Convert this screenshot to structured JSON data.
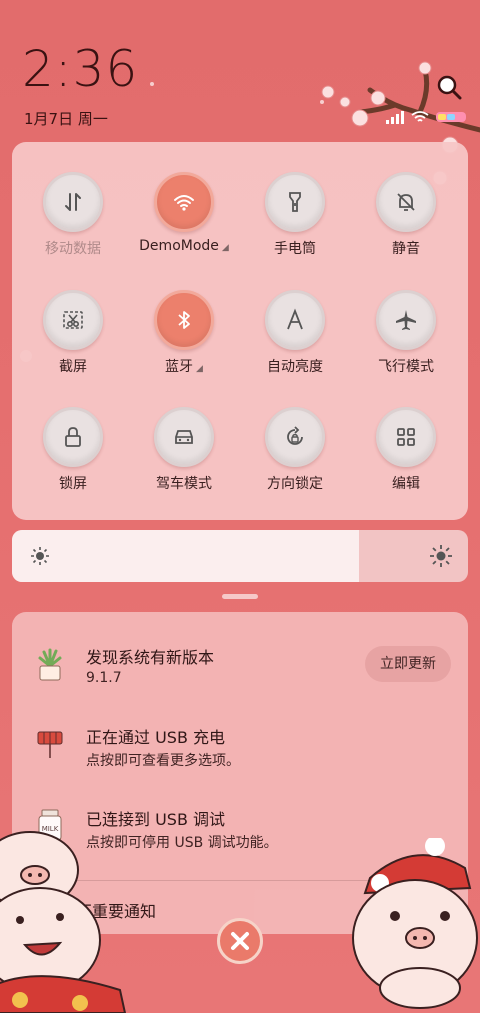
{
  "status": {
    "time": "2:36",
    "date": "1月7日 周一"
  },
  "quick_tiles": [
    {
      "id": "mobile-data",
      "label": "移动数据",
      "active": false,
      "dim": true,
      "icon": "mobile-data-icon"
    },
    {
      "id": "wifi",
      "label": "DemoMode",
      "active": true,
      "dim": false,
      "expandable": true,
      "icon": "wifi-icon"
    },
    {
      "id": "flashlight",
      "label": "手电筒",
      "active": false,
      "dim": false,
      "icon": "flashlight-icon"
    },
    {
      "id": "mute",
      "label": "静音",
      "active": false,
      "dim": false,
      "icon": "bell-off-icon"
    },
    {
      "id": "screenshot",
      "label": "截屏",
      "active": false,
      "dim": false,
      "icon": "scissors-icon"
    },
    {
      "id": "bluetooth",
      "label": "蓝牙",
      "active": true,
      "dim": false,
      "expandable": true,
      "icon": "bluetooth-icon"
    },
    {
      "id": "auto-brightness",
      "label": "自动亮度",
      "active": false,
      "dim": false,
      "icon": "auto-brightness-icon"
    },
    {
      "id": "airplane",
      "label": "飞行模式",
      "active": false,
      "dim": false,
      "icon": "airplane-icon"
    },
    {
      "id": "lock-screen",
      "label": "锁屏",
      "active": false,
      "dim": false,
      "icon": "lock-icon"
    },
    {
      "id": "driving",
      "label": "驾车模式",
      "active": false,
      "dim": false,
      "icon": "car-icon"
    },
    {
      "id": "rotation-lock",
      "label": "方向锁定",
      "active": false,
      "dim": false,
      "icon": "rotation-lock-icon"
    },
    {
      "id": "edit",
      "label": "编辑",
      "active": false,
      "dim": false,
      "icon": "grid-icon"
    }
  ],
  "brightness": {
    "level": 0.76
  },
  "notifications": {
    "update": {
      "title": "发现系统有新版本",
      "body": "9.1.7",
      "action": "立即更新",
      "icon": "plant-icon"
    },
    "usb_charge": {
      "title": "正在通过  USB  充电",
      "body": "点按即可查看更多选项。",
      "icon": "firecracker-icon"
    },
    "usb_debug": {
      "title": "已连接到  USB  调试",
      "body": "点按即可停用 USB 调试功能。",
      "icon": "milk-bottle-icon"
    },
    "unimportant": "不重要通知"
  },
  "theme": {
    "accent": "#ec806c",
    "panel": "#f7c6c6",
    "background": "#e26c6c"
  }
}
